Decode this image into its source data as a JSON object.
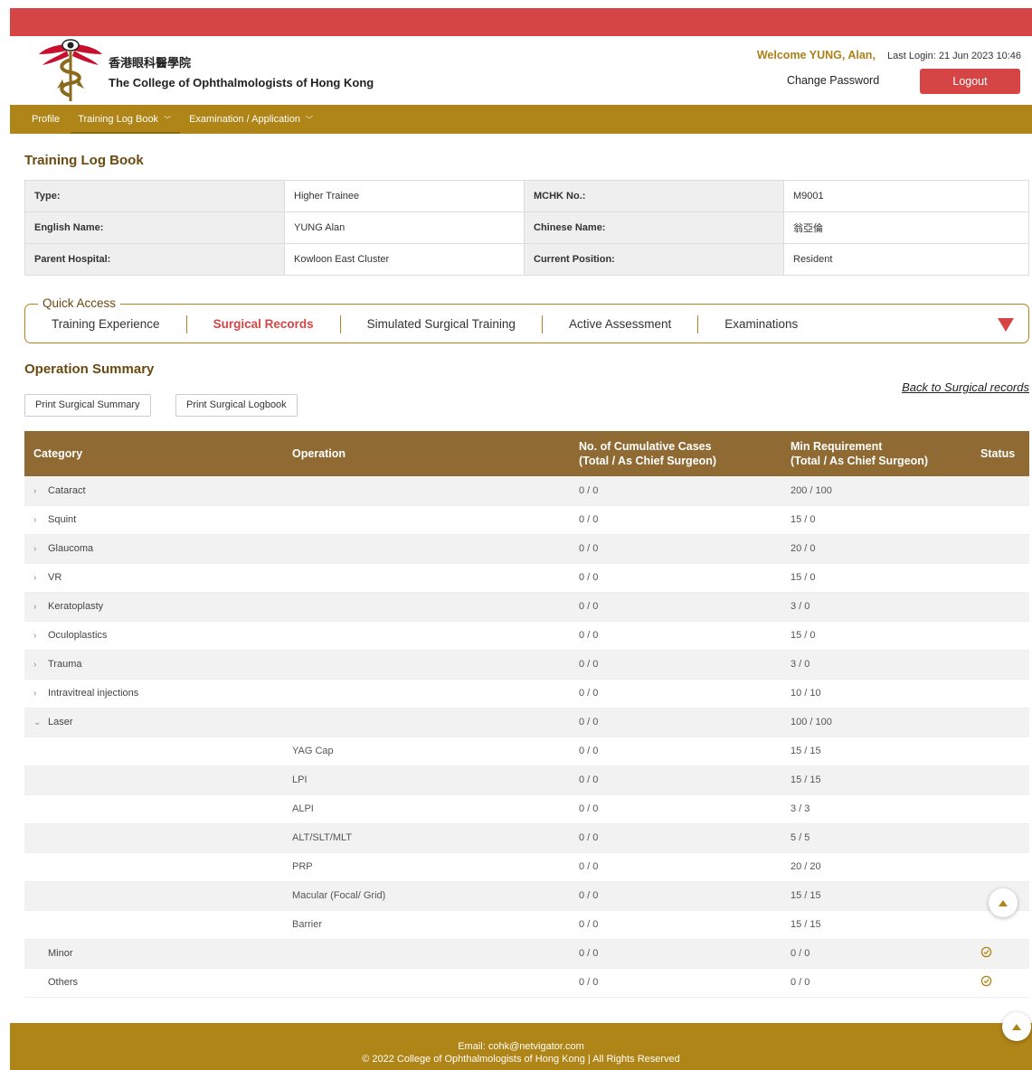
{
  "header": {
    "org_chinese": "香港眼科醫學院",
    "org_english": "The College of Ophthalmologists of Hong Kong",
    "welcome_name": "Welcome YUNG, Alan,",
    "last_login": "Last Login: 21 Jun 2023 10:46",
    "change_password": "Change Password",
    "logout": "Logout"
  },
  "nav": {
    "profile": "Profile",
    "training_log_book": "Training Log Book",
    "examination": "Examination / Application"
  },
  "page_title": "Training Log Book",
  "info": {
    "type_label": "Type:",
    "type_value": "Higher Trainee",
    "mchk_label": "MCHK No.:",
    "mchk_value": "M9001",
    "english_label": "English Name:",
    "english_value": "YUNG Alan",
    "chinese_label": "Chinese Name:",
    "chinese_value": "翁亞倫",
    "hospital_label": "Parent Hospital:",
    "hospital_value": "Kowloon East Cluster",
    "position_label": "Current Position:",
    "position_value": "Resident"
  },
  "quick_access": {
    "legend": "Quick Access",
    "items": [
      "Training Experience",
      "Surgical Records",
      "Simulated Surgical Training",
      "Active Assessment",
      "Examinations"
    ]
  },
  "summary": {
    "title": "Operation Summary",
    "print_summary": "Print Surgical Summary",
    "print_logbook": "Print Surgical Logbook",
    "back_link": "Back to Surgical records",
    "columns": {
      "category": "Category",
      "operation": "Operation",
      "cases_line1": "No. of Cumulative Cases",
      "cases_line2": "(Total / As Chief Surgeon)",
      "req_line1": "Min Requirement",
      "req_line2": "(Total / As Chief Surgeon)",
      "status": "Status"
    },
    "rows": [
      {
        "caret": "›",
        "category": "Cataract",
        "operation": "",
        "cases": "0 / 0",
        "req": "200 / 100",
        "status": ""
      },
      {
        "caret": "›",
        "category": "Squint",
        "operation": "",
        "cases": "0 / 0",
        "req": "15 / 0",
        "status": ""
      },
      {
        "caret": "›",
        "category": "Glaucoma",
        "operation": "",
        "cases": "0 / 0",
        "req": "20 / 0",
        "status": ""
      },
      {
        "caret": "›",
        "category": "VR",
        "operation": "",
        "cases": "0 / 0",
        "req": "15 / 0",
        "status": ""
      },
      {
        "caret": "›",
        "category": "Keratoplasty",
        "operation": "",
        "cases": "0 / 0",
        "req": "3 / 0",
        "status": ""
      },
      {
        "caret": "›",
        "category": "Oculoplastics",
        "operation": "",
        "cases": "0 / 0",
        "req": "15 / 0",
        "status": ""
      },
      {
        "caret": "›",
        "category": "Trauma",
        "operation": "",
        "cases": "0 / 0",
        "req": "3 / 0",
        "status": ""
      },
      {
        "caret": "›",
        "category": "Intravitreal injections",
        "operation": "",
        "cases": "0 / 0",
        "req": "10 / 10",
        "status": ""
      },
      {
        "caret": "⌄",
        "category": "Laser",
        "operation": "",
        "cases": "0 / 0",
        "req": "100 / 100",
        "status": ""
      },
      {
        "caret": "",
        "category": "",
        "operation": "YAG Cap",
        "cases": "0 / 0",
        "req": "15 / 15",
        "status": ""
      },
      {
        "caret": "",
        "category": "",
        "operation": "LPI",
        "cases": "0 / 0",
        "req": "15 / 15",
        "status": ""
      },
      {
        "caret": "",
        "category": "",
        "operation": "ALPI",
        "cases": "0 / 0",
        "req": "3 / 3",
        "status": ""
      },
      {
        "caret": "",
        "category": "",
        "operation": "ALT/SLT/MLT",
        "cases": "0 / 0",
        "req": "5 / 5",
        "status": ""
      },
      {
        "caret": "",
        "category": "",
        "operation": "PRP",
        "cases": "0 / 0",
        "req": "20 / 20",
        "status": ""
      },
      {
        "caret": "",
        "category": "",
        "operation": "Macular (Focal/ Grid)",
        "cases": "0 / 0",
        "req": "15 / 15",
        "status": ""
      },
      {
        "caret": "",
        "category": "",
        "operation": "Barrier",
        "cases": "0 / 0",
        "req": "15 / 15",
        "status": ""
      },
      {
        "caret": "",
        "category": "Minor",
        "operation": "",
        "cases": "0 / 0",
        "req": "0 / 0",
        "status": "check-circle-icon"
      },
      {
        "caret": "",
        "category": "Others",
        "operation": "",
        "cases": "0 / 0",
        "req": "0 / 0",
        "status": "check-circle-icon"
      }
    ]
  },
  "footer": {
    "email": "Email: cohk@netvigator.com",
    "copyright": "© 2022 College of Ophthalmologists of Hong Kong | All Rights Reserved"
  },
  "colors": {
    "brand_gold": "#b08518",
    "brand_red": "#d64545",
    "table_header": "#8f6a33"
  }
}
